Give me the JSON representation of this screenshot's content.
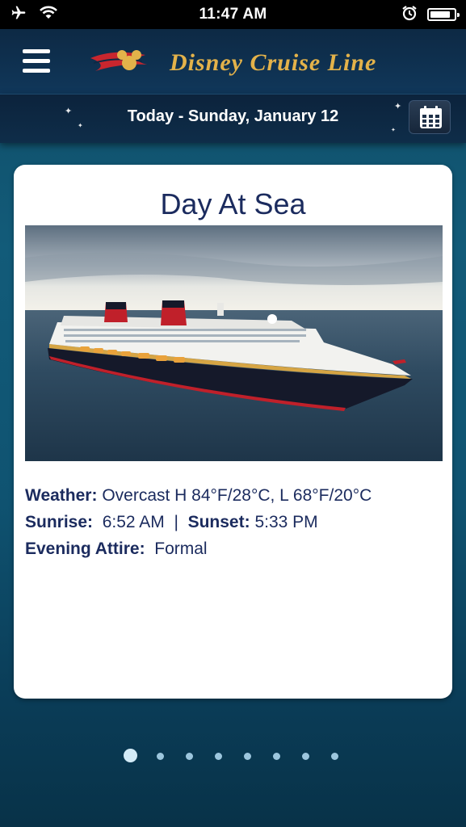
{
  "status_bar": {
    "time": "11:47 AM",
    "icons": [
      "airplane-icon",
      "wifi-icon",
      "alarm-icon",
      "battery-icon"
    ]
  },
  "header": {
    "logo_text": "Disney Cruise Line",
    "menu_icon": "hamburger-menu-icon"
  },
  "date_bar": {
    "label": "Today - Sunday, January 12",
    "calendar_icon": "calendar-icon"
  },
  "day_card": {
    "title": "Day At Sea",
    "image_alt": "Disney cruise ship at sea",
    "weather_label": "Weather:",
    "weather_value": "Overcast H 84°F/28°C, L 68°F/20°C",
    "sunrise_label": "Sunrise:",
    "sunrise_value": "6:52 AM",
    "separator": "|",
    "sunset_label": "Sunset:",
    "sunset_value": "5:33 PM",
    "attire_label": "Evening Attire:",
    "attire_value": "Formal"
  },
  "pager": {
    "count": 8,
    "active_index": 0
  },
  "colors": {
    "brand_navy": "#1b2b5e",
    "logo_gold": "#e3b24a",
    "header_bg": "#0d2944",
    "background_teal": "#125b79"
  }
}
